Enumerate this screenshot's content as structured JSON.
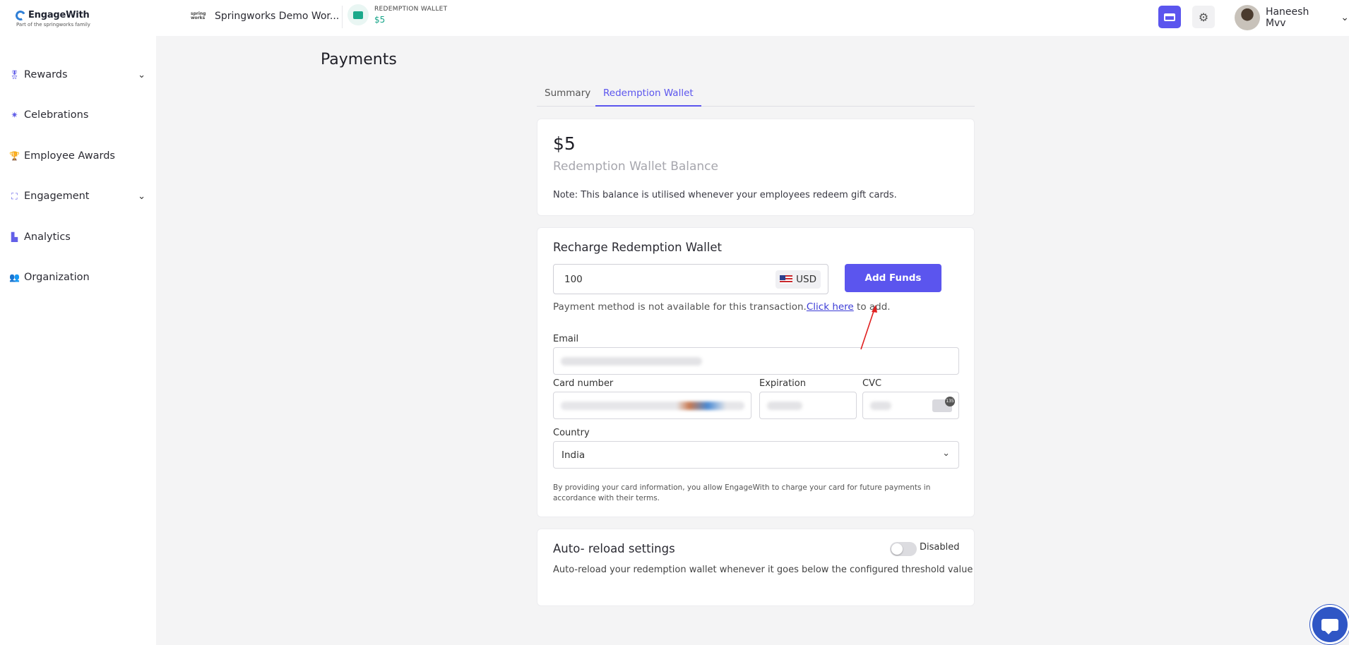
{
  "brand": {
    "name": "EngageWith",
    "tagline": "Part of the springworks family"
  },
  "workspace": {
    "logo_text": "spring works",
    "name": "Springworks Demo Wor..."
  },
  "wallet": {
    "label": "REDEMPTION WALLET",
    "amount": "$5"
  },
  "user": {
    "name": "Haneesh Mvv"
  },
  "sidebar": {
    "items": [
      {
        "label": "Rewards",
        "icon": "medal-icon",
        "has_chevron": true
      },
      {
        "label": "Celebrations",
        "icon": "party-popper-icon",
        "has_chevron": false
      },
      {
        "label": "Employee Awards",
        "icon": "trophy-icon",
        "has_chevron": false
      },
      {
        "label": "Engagement",
        "icon": "flow-icon",
        "has_chevron": true
      },
      {
        "label": "Analytics",
        "icon": "bar-chart-icon",
        "has_chevron": false
      },
      {
        "label": "Organization",
        "icon": "people-icon",
        "has_chevron": false
      }
    ]
  },
  "page": {
    "title": "Payments",
    "tabs": [
      {
        "label": "Summary",
        "active": false
      },
      {
        "label": "Redemption Wallet",
        "active": true
      }
    ]
  },
  "balance": {
    "amount": "$5",
    "label": "Redemption Wallet Balance",
    "note": "Note: This balance is utilised whenever your employees redeem gift cards."
  },
  "recharge": {
    "title": "Recharge Redemption Wallet",
    "amount_value": "100",
    "currency": "USD",
    "add_button": "Add Funds",
    "payment_note": "Payment method is not available for this transaction.",
    "payment_link": "Click here",
    "payment_note_suffix": " to add.",
    "email_label": "Email",
    "card_number_label": "Card number",
    "expiration_label": "Expiration",
    "cvc_label": "CVC",
    "country_label": "Country",
    "country_value": "India",
    "terms": "By providing your card information, you allow EngageWith to charge your card for future payments in accordance with their terms."
  },
  "auto_reload": {
    "title": "Auto- reload settings",
    "status": "Disabled",
    "enabled": false,
    "description": "Auto-reload your redemption wallet whenever it goes below the configured threshold value"
  },
  "colors": {
    "accent": "#5b55ee",
    "wallet_green": "#17a589",
    "annotation_arrow": "#e02020"
  }
}
